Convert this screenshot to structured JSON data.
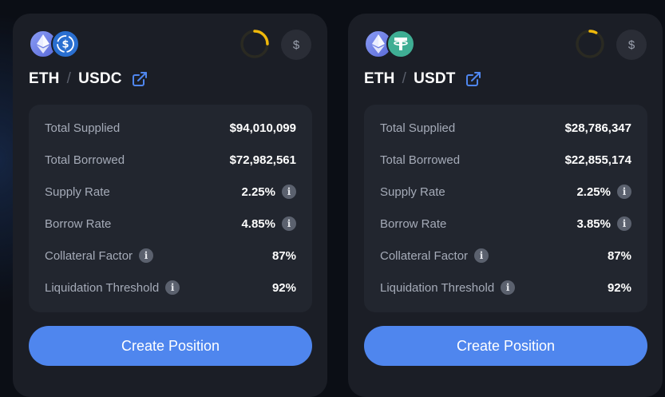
{
  "pools": [
    {
      "base_token": "ETH",
      "quote_token": "USDC",
      "separator": "/",
      "icons": [
        "eth-icon",
        "usdc-icon",
        "external-link-icon",
        "dollar-icon",
        "info-icon"
      ],
      "dollar_symbol": "$",
      "progress": 0.25,
      "stats": [
        {
          "label": "Total Supplied",
          "value": "$94,010,099"
        },
        {
          "label": "Total Borrowed",
          "value": "$72,982,561"
        },
        {
          "label": "Supply Rate",
          "value": "2.25%"
        },
        {
          "label": "Borrow Rate",
          "value": "4.85%"
        },
        {
          "label": "Collateral Factor",
          "value": "87%"
        },
        {
          "label": "Liquidation Threshold",
          "value": "92%"
        }
      ],
      "button_label": "Create Position"
    },
    {
      "base_token": "ETH",
      "quote_token": "USDT",
      "separator": "/",
      "icons": [
        "eth-icon",
        "usdt-icon",
        "external-link-icon",
        "dollar-icon",
        "info-icon"
      ],
      "dollar_symbol": "$",
      "progress": 0.08,
      "stats": [
        {
          "label": "Total Supplied",
          "value": "$28,786,347"
        },
        {
          "label": "Total Borrowed",
          "value": "$22,855,174"
        },
        {
          "label": "Supply Rate",
          "value": "2.25%"
        },
        {
          "label": "Borrow Rate",
          "value": "3.85%"
        },
        {
          "label": "Collateral Factor",
          "value": "87%"
        },
        {
          "label": "Liquidation Threshold",
          "value": "92%"
        }
      ],
      "button_label": "Create Position"
    }
  ],
  "info_glyph": "i",
  "colors": {
    "background": "#0b0e15",
    "card": "#1b1e26",
    "stats_panel": "#22262f",
    "accent_button": "#4f86ee",
    "progress_ring": "#f0b90b",
    "link_icon": "#4f86ee"
  }
}
